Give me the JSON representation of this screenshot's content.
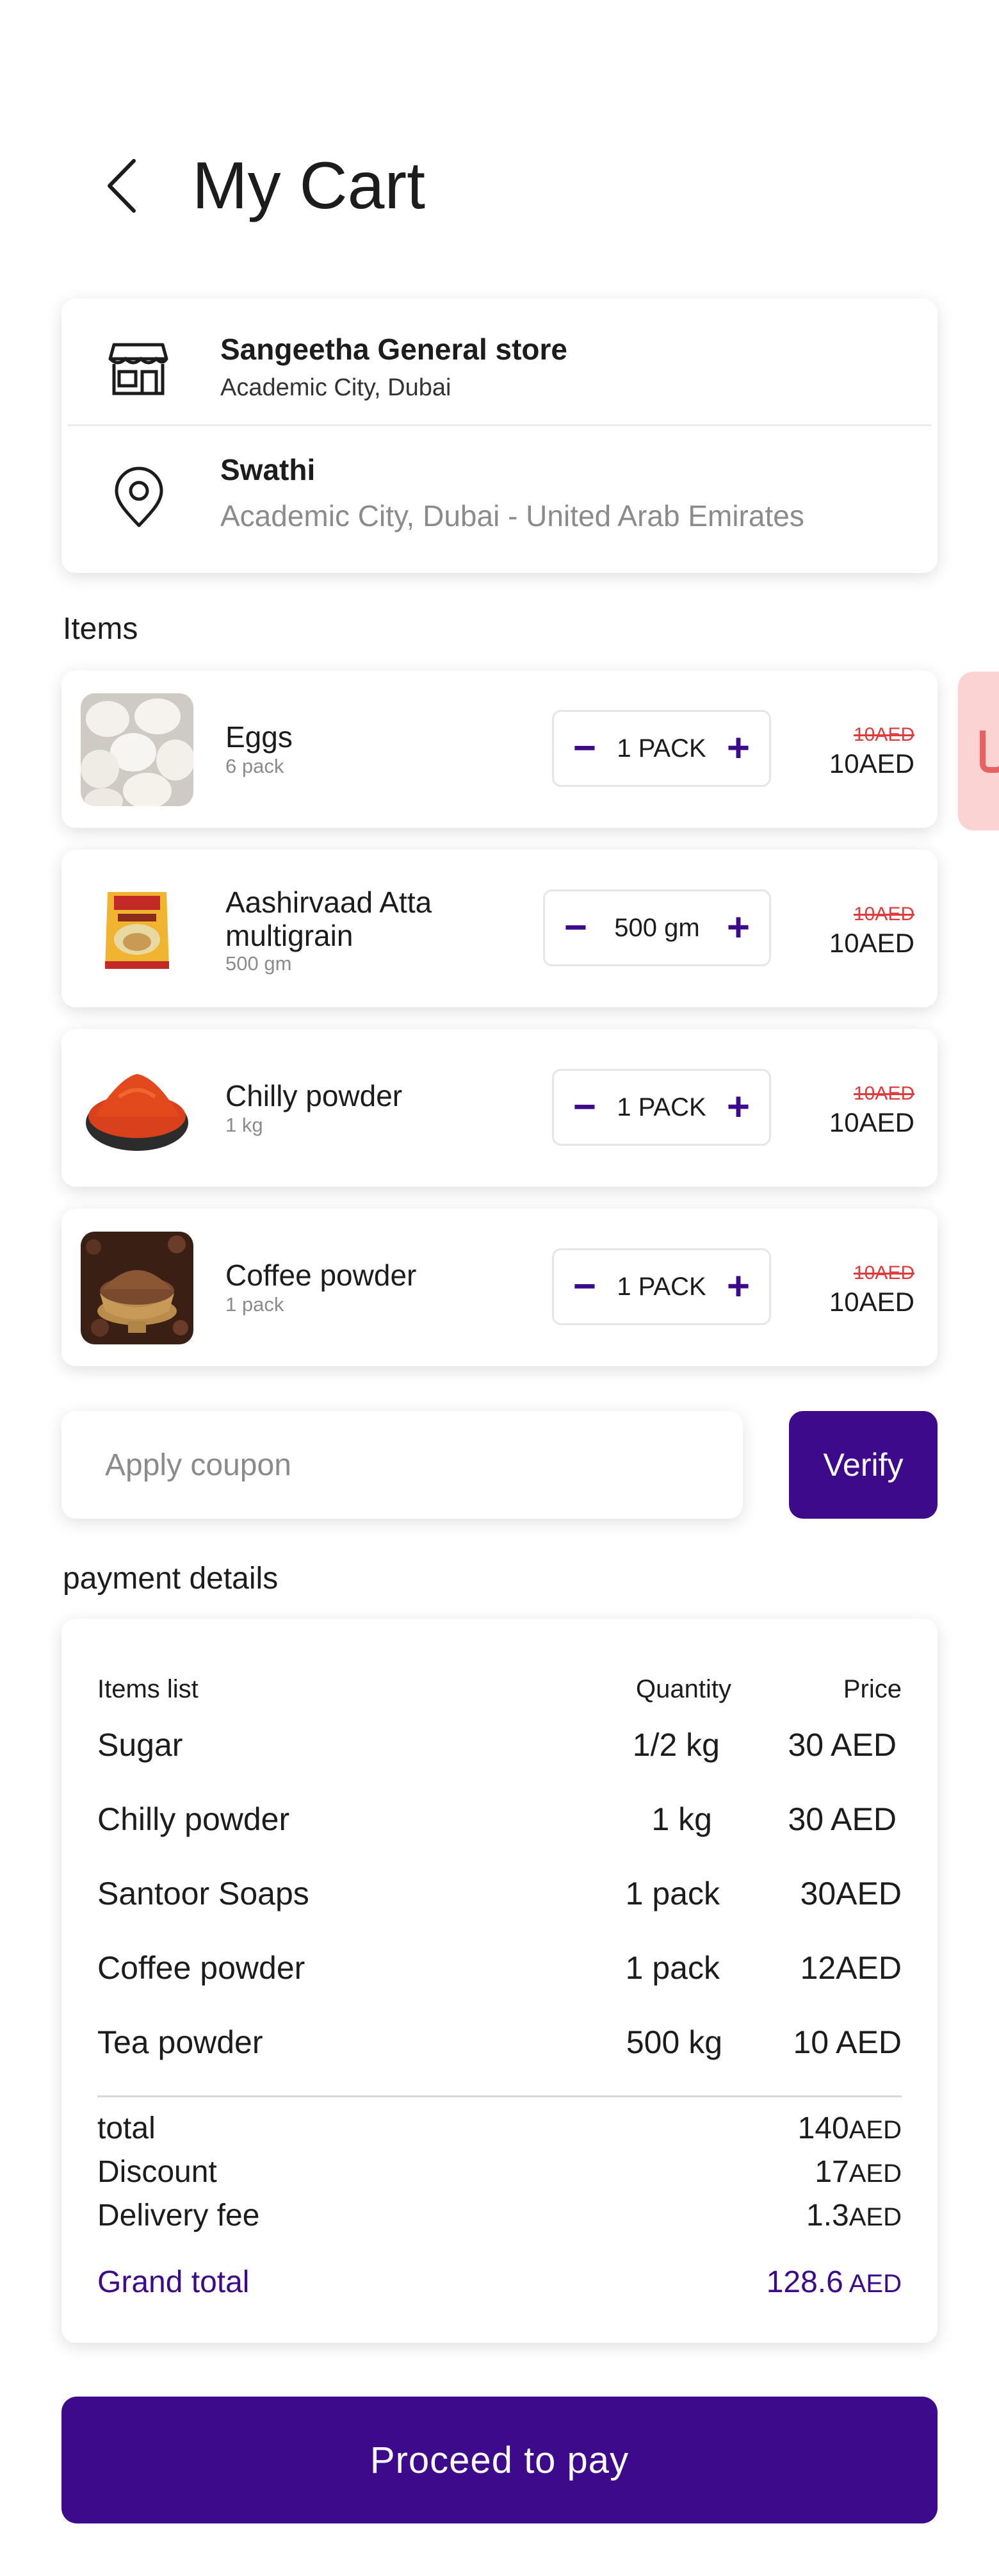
{
  "header": {
    "title": "My Cart"
  },
  "store": {
    "name": "Sangeetha General store",
    "location": "Academic City, Dubai"
  },
  "address": {
    "name": "Swathi",
    "line": "Academic City, Dubai - United Arab Emirates"
  },
  "items_label": "Items",
  "items": [
    {
      "name": "Eggs",
      "sub": "6 pack",
      "qty": "1 PACK",
      "old_price": "10AED",
      "price": "10AED"
    },
    {
      "name": "Aashirvaad Atta multigrain",
      "sub": "500 gm",
      "qty": "500 gm",
      "old_price": "10AED",
      "price": "10AED"
    },
    {
      "name": "Chilly powder",
      "sub": "1 kg",
      "qty": "1 PACK",
      "old_price": "10AED",
      "price": "10AED"
    },
    {
      "name": "Coffee powder",
      "sub": "1 pack",
      "qty": "1 PACK",
      "old_price": "10AED",
      "price": "10AED"
    }
  ],
  "stepper": {
    "minus": "−",
    "plus": "+"
  },
  "coupon": {
    "placeholder": "Apply coupon",
    "verify_label": "Verify"
  },
  "payment_label": "payment details",
  "payment": {
    "headers": {
      "items": "Items list",
      "quantity": "Quantity",
      "price": "Price"
    },
    "rows": [
      {
        "name": "Sugar",
        "qty": "1/2 kg",
        "price": "30 AED"
      },
      {
        "name": "Chilly powder",
        "qty": "1 kg",
        "price": "30 AED"
      },
      {
        "name": "Santoor Soaps",
        "qty": "1 pack",
        "price": "30AED"
      },
      {
        "name": "Coffee powder",
        "qty": "1 pack",
        "price": "12AED"
      },
      {
        "name": "Tea powder",
        "qty": "500 kg",
        "price": "10 AED"
      }
    ],
    "total_label": "total",
    "total_value": "140",
    "total_unit": "AED",
    "discount_label": "Discount",
    "discount_value": "17",
    "discount_unit": "AED",
    "delivery_label": "Delivery fee",
    "delivery_value": "1.3",
    "delivery_unit": "AED",
    "grand_label": "Grand total",
    "grand_value": "128.6",
    "grand_unit": " AED"
  },
  "proceed_label": "Proceed to pay",
  "colors": {
    "accent": "#3c0a8a",
    "strike": "#e03a3a",
    "muted": "#8b8b8b",
    "delete_bg": "#fbd3d3"
  }
}
